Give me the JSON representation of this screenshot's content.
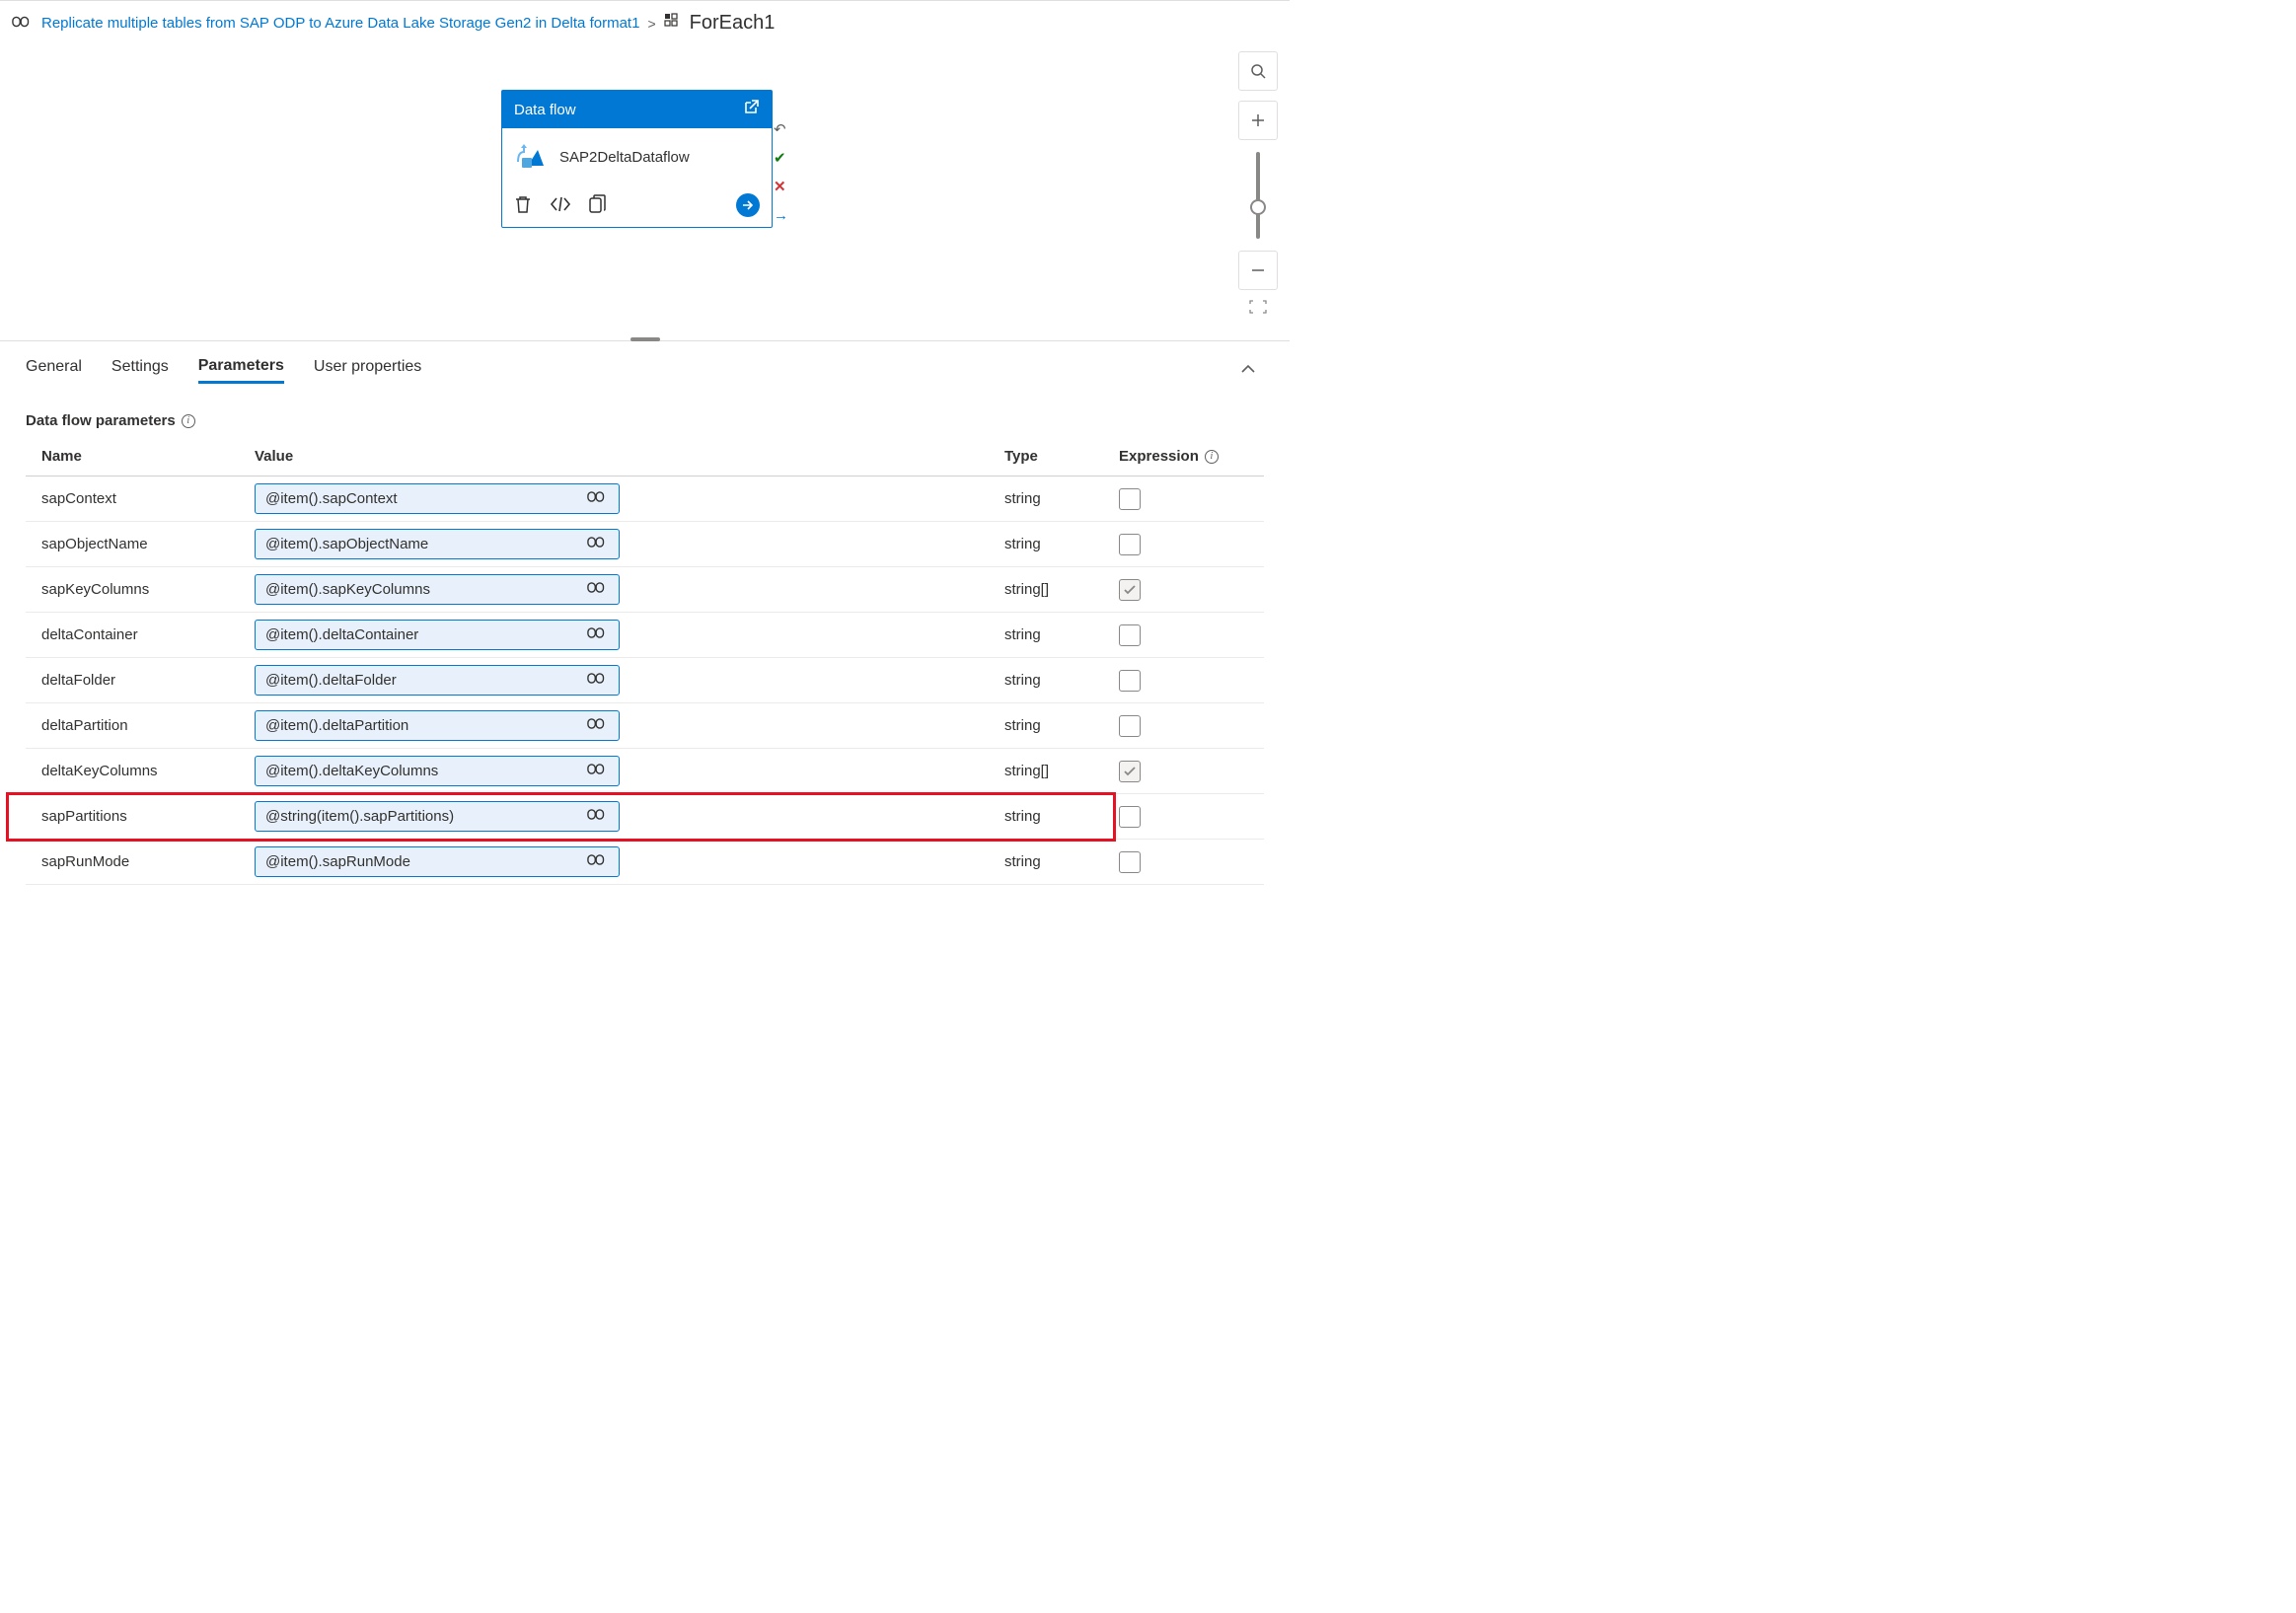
{
  "breadcrumb": {
    "link_text": "Replicate multiple tables from SAP ODP to Azure Data Lake Storage Gen2 in Delta format1",
    "current": "ForEach1"
  },
  "activity": {
    "header": "Data flow",
    "name": "SAP2DeltaDataflow"
  },
  "tabs": {
    "general": "General",
    "settings": "Settings",
    "parameters": "Parameters",
    "user_properties": "User properties"
  },
  "section": {
    "title": "Data flow parameters"
  },
  "columns": {
    "name": "Name",
    "value": "Value",
    "type": "Type",
    "expression": "Expression"
  },
  "params": [
    {
      "name": "sapContext",
      "value": "@item().sapContext",
      "type": "string",
      "expr": false
    },
    {
      "name": "sapObjectName",
      "value": "@item().sapObjectName",
      "type": "string",
      "expr": false
    },
    {
      "name": "sapKeyColumns",
      "value": "@item().sapKeyColumns",
      "type": "string[]",
      "expr": true
    },
    {
      "name": "deltaContainer",
      "value": "@item().deltaContainer",
      "type": "string",
      "expr": false
    },
    {
      "name": "deltaFolder",
      "value": "@item().deltaFolder",
      "type": "string",
      "expr": false
    },
    {
      "name": "deltaPartition",
      "value": "@item().deltaPartition",
      "type": "string",
      "expr": false
    },
    {
      "name": "deltaKeyColumns",
      "value": "@item().deltaKeyColumns",
      "type": "string[]",
      "expr": true
    },
    {
      "name": "sapPartitions",
      "value": "@string(item().sapPartitions)",
      "type": "string",
      "expr": false
    },
    {
      "name": "sapRunMode",
      "value": "@item().sapRunMode",
      "type": "string",
      "expr": false
    }
  ],
  "highlight_row_index": 7
}
